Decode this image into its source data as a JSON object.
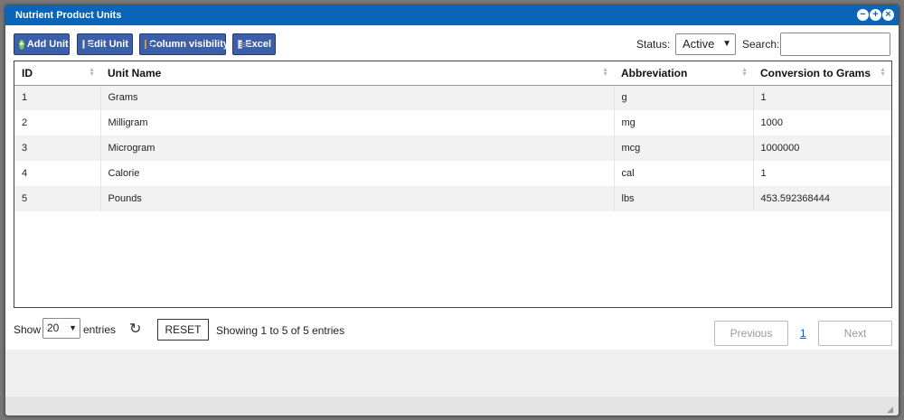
{
  "window": {
    "title": "Nutrient Product Units"
  },
  "toolbar": {
    "buttons": [
      {
        "label": "Add Unit",
        "icon": "add-circle-icon"
      },
      {
        "label": "Edit Unit",
        "icon": "edit-document-icon"
      },
      {
        "label": "Column visibility",
        "icon": "columns-icon"
      },
      {
        "label": "Excel",
        "icon": "spreadsheet-icon"
      }
    ],
    "status_label": "Status:",
    "status_value": "Active",
    "search_label": "Search:",
    "search_value": ""
  },
  "table": {
    "columns": [
      "ID",
      "Unit Name",
      "Abbreviation",
      "Conversion to Grams"
    ],
    "rows": [
      [
        "1",
        "Grams",
        "g",
        "1"
      ],
      [
        "2",
        "Milligram",
        "mg",
        "1000"
      ],
      [
        "3",
        "Microgram",
        "mcg",
        "1000000"
      ],
      [
        "4",
        "Calorie",
        "cal",
        "1"
      ],
      [
        "5",
        "Pounds",
        "lbs",
        "453.592368444"
      ]
    ]
  },
  "footer": {
    "show_label": "Show",
    "page_length": "20",
    "entries_label": "entries",
    "reset_label": "RESET",
    "info": "Showing 1 to 5 of 5 entries",
    "previous_label": "Previous",
    "current_page": "1",
    "next_label": "Next"
  },
  "colors": {
    "titlebar": "#0a64b8",
    "button": "#3b5fa8",
    "link": "#1a55d0"
  }
}
